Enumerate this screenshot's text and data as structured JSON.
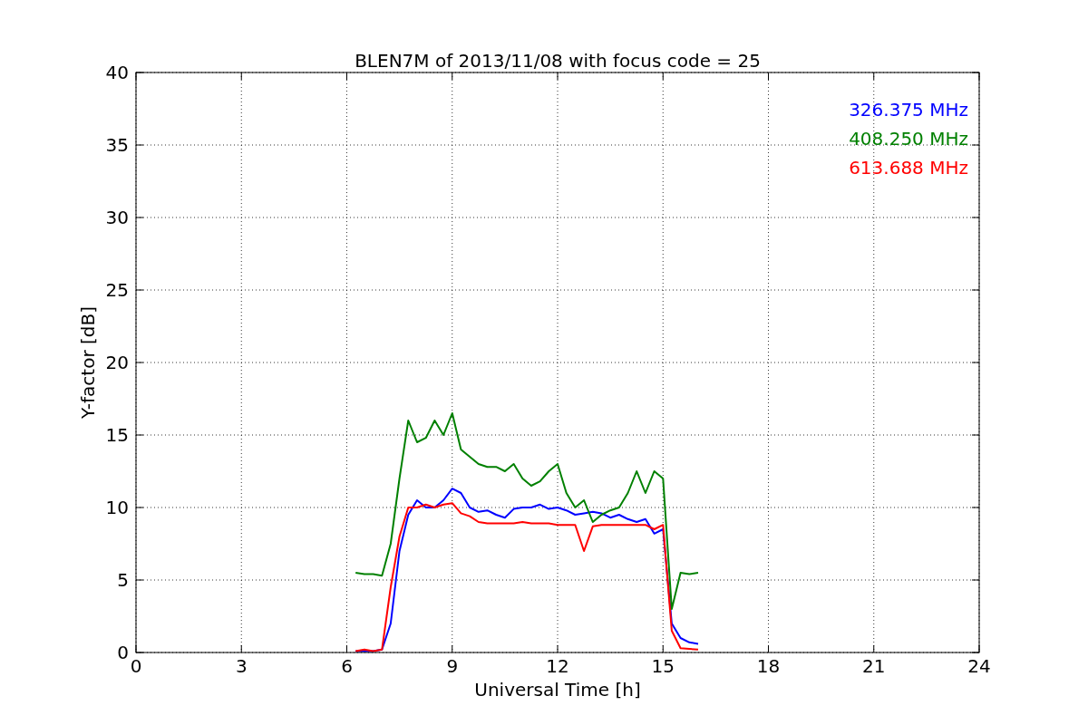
{
  "chart_data": {
    "type": "line",
    "title": "BLEN7M of 2013/11/08 with focus code = 25",
    "xlabel": "Universal Time [h]",
    "ylabel": "Y-factor [dB]",
    "x": [
      6.25,
      6.5,
      6.75,
      7,
      7.25,
      7.5,
      7.75,
      8,
      8.25,
      8.5,
      8.75,
      9,
      9.25,
      9.5,
      9.75,
      10,
      10.25,
      10.5,
      10.75,
      11,
      11.25,
      11.5,
      11.75,
      12,
      12.25,
      12.5,
      12.75,
      13,
      13.25,
      13.5,
      13.75,
      14,
      14.25,
      14.5,
      14.75,
      15,
      15.25,
      15.5,
      15.75,
      16
    ],
    "series": [
      {
        "name": "326.375 MHz",
        "color": "#0000ff",
        "values": [
          0.1,
          0.1,
          0.1,
          0.2,
          2,
          7,
          9.5,
          10.5,
          10,
          10,
          10.5,
          11.3,
          11,
          10,
          9.7,
          9.8,
          9.5,
          9.3,
          9.9,
          10,
          10,
          10.2,
          9.9,
          10,
          9.8,
          9.5,
          9.6,
          9.7,
          9.6,
          9.3,
          9.5,
          9.2,
          9,
          9.2,
          8.2,
          8.5,
          2,
          1,
          0.7,
          0.6
        ]
      },
      {
        "name": "408.250 MHz",
        "color": "#008000",
        "values": [
          5.5,
          5.4,
          5.4,
          5.3,
          7.5,
          12,
          16,
          14.5,
          14.8,
          16,
          15,
          16.5,
          14,
          13.5,
          13,
          12.8,
          12.8,
          12.5,
          13,
          12,
          11.5,
          11.8,
          12.5,
          13,
          11,
          10,
          10.5,
          9,
          9.5,
          9.8,
          10,
          11,
          12.5,
          11,
          12.5,
          12,
          3,
          5.5,
          5.4,
          5.5
        ]
      },
      {
        "name": "613.688 MHz",
        "color": "#ff0000",
        "values": [
          0.1,
          0.2,
          0.1,
          0.2,
          4.5,
          8,
          10,
          10,
          10.2,
          10,
          10.2,
          10.3,
          9.6,
          9.4,
          9,
          8.9,
          8.9,
          8.9,
          8.9,
          9,
          8.9,
          8.9,
          8.9,
          8.8,
          8.8,
          8.8,
          7,
          8.7,
          8.8,
          8.8,
          8.8,
          8.8,
          8.8,
          8.8,
          8.5,
          8.8,
          1.5,
          0.3,
          0.25,
          0.2
        ]
      }
    ],
    "grid": true,
    "xlim": [
      0,
      24
    ],
    "ylim": [
      0,
      40
    ],
    "xticks": [
      0,
      3,
      6,
      9,
      12,
      15,
      18,
      21,
      24
    ],
    "yticks": [
      0,
      5,
      10,
      15,
      20,
      25,
      30,
      35,
      40
    ]
  }
}
